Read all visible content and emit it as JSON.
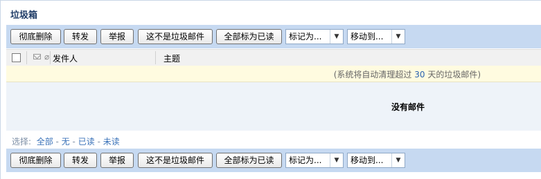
{
  "folder": {
    "title": "垃圾箱"
  },
  "toolbar": {
    "delete_label": "彻底删除",
    "forward_label": "转发",
    "report_label": "举报",
    "not_spam_label": "这不是垃圾邮件",
    "mark_all_read_label": "全部标为已读",
    "mark_as_select": "标记为...",
    "move_to_select": "移动到..."
  },
  "list_header": {
    "sender_label": "发件人",
    "subject_label": "主题"
  },
  "notice": {
    "prefix": "(系统将自动清理超过",
    "days": "30",
    "suffix": "天的垃圾邮件)"
  },
  "empty_message": "没有邮件",
  "selection": {
    "label": "选择:",
    "all": "全部",
    "none": "无",
    "read": "已读",
    "unread": "未读",
    "separator": "-"
  },
  "colors": {
    "toolbar_bg": "#c6d9f1",
    "notice_bg": "#fffbe0",
    "empty_bg": "#eef3f9",
    "link": "#3b73b9",
    "title": "#1e3b66"
  }
}
